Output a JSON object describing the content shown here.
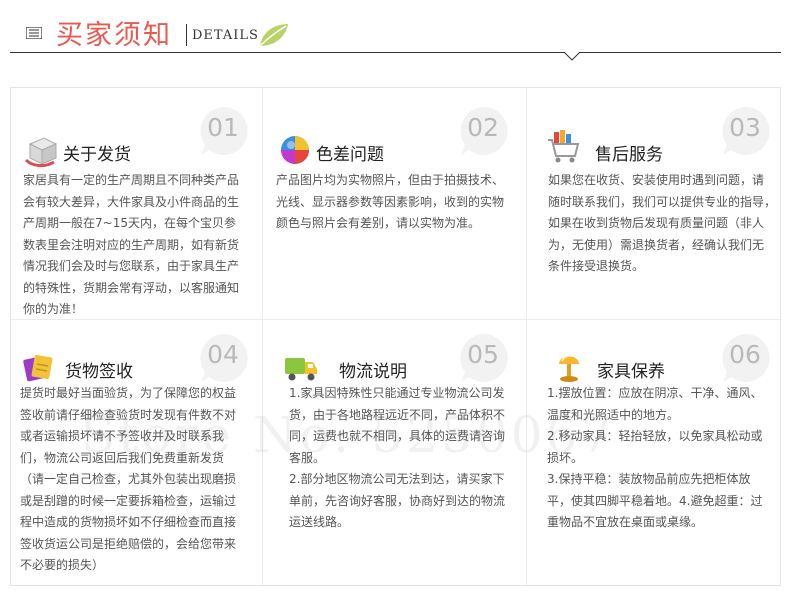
{
  "header": {
    "title_cn": "买家须知",
    "title_en": "DETAILS",
    "icon": "menu-icon",
    "leaf": "leaf-icon"
  },
  "accent_color": "#e85a4f",
  "watermark": "Store No: 5250067",
  "items": [
    {
      "number": "01",
      "title": "关于发货",
      "icon": "shipping-box-icon",
      "lines": [
        "家居具有一定的生产周期且不同种类产品",
        "会有较大差异，大件家具及小件商品的生",
        "产周期一般在7~15天内，在每个宝贝参",
        "数表里会注明对应的生产周期，如有新货",
        "情况我们会及时与您联系，由于家具生产",
        "的特殊性，货期会常有浮动，以客服通知",
        "你的为准！"
      ]
    },
    {
      "number": "02",
      "title": "色差问题",
      "icon": "color-ball-icon",
      "lines": [
        "产品图片均为实物照片，但由于拍摄技术、",
        "光线、显示器参数等因素影响，收到的实物",
        "颜色与照片会有差别，请以实物为准。"
      ]
    },
    {
      "number": "03",
      "title": "售后服务",
      "icon": "shopping-cart-icon",
      "lines": [
        "如果您在收货、安装使用时遇到问题，请",
        "随时联系我们，我们可以提供专业的指导，",
        "如果在收到货物后发现有质量问题（非人",
        "为，无使用）需退换货者，经确认我们无",
        "条件接受退换货。"
      ]
    },
    {
      "number": "04",
      "title": "货物签收",
      "icon": "package-sign-icon",
      "lines": [
        "提货时最好当面验货，为了保障您的权益",
        "签收前请仔细检查验货时发现有件数不对",
        "或者运输损坏请不予签收并及时联系我",
        "们，物流公司返回后我们免费重新发货",
        "（请一定自己检查，尤其外包装出现磨损",
        "或是刮蹭的时候一定要拆箱检查，运输过",
        "程中造成的货物损坏如不仔细检查而直接",
        "签收货运公司是拒绝赔偿的，会给您带来",
        "不必要的损失）"
      ]
    },
    {
      "number": "05",
      "title": "物流说明",
      "icon": "truck-icon",
      "lines": [
        "1.家具因特殊性只能通过专业物流公司发",
        "货，由于各地路程远近不同，产品体积不",
        "同，运费也就不相同，具体的运费请咨询",
        "客服。",
        "2.部分地区物流公司无法到达，请买家下",
        "单前，先咨询好客服，协商好到达的物流",
        "运送线路。"
      ]
    },
    {
      "number": "06",
      "title": "家具保养",
      "icon": "lamp-icon",
      "lines": [
        "1.摆放位置：应放在阴凉、干净、通风、",
        "温度和光照适中的地方。",
        "2.移动家具：轻抬轻放，以免家具松动或",
        "损坏。",
        "3.保持平稳：装放物品前应先把柜体放",
        "平，使其四脚平稳着地。4.避免超重：过",
        "重物品不宜放在桌面或桌缘。"
      ]
    }
  ]
}
